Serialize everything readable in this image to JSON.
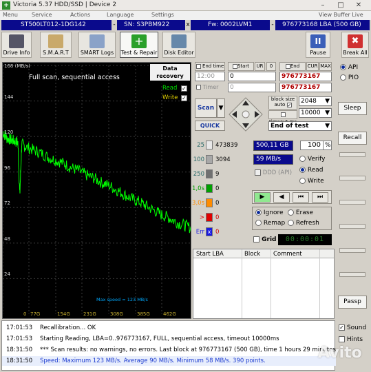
{
  "window": {
    "title": "Victoria 5.37 HDD/SSD  |  Device 2"
  },
  "menu": [
    "Menu",
    "Service",
    "Actions",
    "Language",
    "Settings",
    "View Buffer Live"
  ],
  "infobar": {
    "model": "ST500LT012-1DG142",
    "sn": "SN: S3PBM922",
    "fw": "Fw: 0002LVM1",
    "lba": "976773168 LBA (500 GB)"
  },
  "toolbar": {
    "drive_info": "Drive Info",
    "smart": "S.M.A.R.T",
    "smart_logs": "SMART Logs",
    "test_repair": "Test & Repair",
    "disk_editor": "Disk Editor",
    "pause": "Pause",
    "break_all": "Break All"
  },
  "graph": {
    "top_label": "168 (MB/s)",
    "title1": "Full scan, sequential access",
    "title2": "ST500LT012-1DG142",
    "watermark1": "Data recovery",
    "watermark2": "www.hdd.by",
    "read_label": "Read",
    "write_label": "Write",
    "max_speed": "Max speed = 123 MB/s",
    "ylabels": [
      "144",
      "120",
      "96",
      "72",
      "48",
      "24"
    ],
    "xlabels": [
      "0",
      "77G",
      "154G",
      "231G",
      "308G",
      "385G",
      "462G"
    ]
  },
  "chart_data": {
    "type": "line",
    "title": "Full scan, sequential access",
    "subtitle": "ST500LT012-1DG142",
    "ylabel": "(MB/s)",
    "ylim": [
      0,
      168
    ],
    "xlim": [
      0,
      500
    ],
    "yticks": [
      24,
      48,
      72,
      96,
      120,
      144,
      168
    ],
    "xtick_labels": [
      "0",
      "77G",
      "154G",
      "231G",
      "308G",
      "385G",
      "462G"
    ],
    "grid": true,
    "series": [
      {
        "name": "Read",
        "color": "#00ff00",
        "x": [
          0,
          10,
          20,
          30,
          40,
          45,
          50,
          60,
          80,
          100,
          120,
          140,
          160,
          180,
          200,
          220,
          240,
          260,
          280,
          300,
          320,
          340,
          360,
          380,
          400,
          420,
          440,
          460,
          480,
          500
        ],
        "y": [
          123,
          119,
          118,
          117,
          116,
          80,
          115,
          113,
          111,
          109,
          106,
          104,
          102,
          99,
          97,
          94,
          92,
          89,
          87,
          84,
          81,
          78,
          76,
          73,
          70,
          67,
          65,
          62,
          60,
          58
        ]
      }
    ]
  },
  "controls": {
    "end_time_label": "End time",
    "end_time_value": "12:00",
    "timer_label": "Timer",
    "timer_value": "0",
    "start_lba_label": "Start LBA",
    "ur_label": "UR",
    "start_lba_value": "0",
    "start_lba_zero": "0",
    "end_lba_label": "End LBA",
    "cur_label": "CUR",
    "max_label": "MAX",
    "end_lba_value": "976773167",
    "end_lba_value2": "976773167",
    "scan": "Scan",
    "quick": "QUICK",
    "block_size_label": "block size",
    "auto_label": "auto",
    "block_size_value": "2048",
    "timeout_label": "timeout,ms",
    "timeout_value": "10000",
    "end_of_test": "End of test",
    "api": "API",
    "pio": "PIO",
    "sleep": "Sleep",
    "recall": "Recall",
    "passp": "Passp"
  },
  "stats": {
    "rows": [
      {
        "label": "25",
        "count": "473839",
        "color": "#e8e8e8"
      },
      {
        "label": "100",
        "count": "3094",
        "color": "#a8a8a8"
      },
      {
        "label": "250",
        "count": "9",
        "color": "#707070"
      },
      {
        "label": "1,0s",
        "count": "0",
        "color": "#00a000"
      },
      {
        "label": "3,0s",
        "count": "0",
        "color": "#ff8c00"
      },
      {
        "label": ">",
        "count": "0",
        "color": "#e00000"
      },
      {
        "label": "Err",
        "count": "0",
        "color": "#1a1ae0"
      }
    ],
    "capacity": "500,11 GB",
    "percent": "100",
    "percent_unit": "%",
    "speed": "59 MB/s",
    "ddd_api": "DDD (API)",
    "verify": "Verify",
    "read": "Read",
    "write": "Write",
    "ignore": "Ignore",
    "erase": "Erase",
    "remap": "Remap",
    "refresh": "Refresh",
    "grid": "Grid",
    "timer": "00:00:01"
  },
  "table": {
    "headers": [
      "Start LBA",
      "Block",
      "Comment"
    ]
  },
  "log": [
    {
      "time": "17:01:53",
      "text": "Recallibration... OK",
      "color": "#000000"
    },
    {
      "time": "17:01:53",
      "text": "Starting Reading, LBA=0..976773167, FULL, sequential access, timeout 10000ms",
      "color": "#000000"
    },
    {
      "time": "18:31:50",
      "text": "*** Scan results: no warnings, no errors. Last block at 976773167 (500 GB), time 1 hours 29 minutes",
      "color": "#000000"
    },
    {
      "time": "18:31:50",
      "text": "Speed: Maximum 123 MB/s. Average 90 MB/s. Minimum 58 MB/s. 390 points.",
      "color": "#1a3ad0"
    }
  ],
  "sound": "Sound",
  "hints": "Hints",
  "avito": "Avito"
}
